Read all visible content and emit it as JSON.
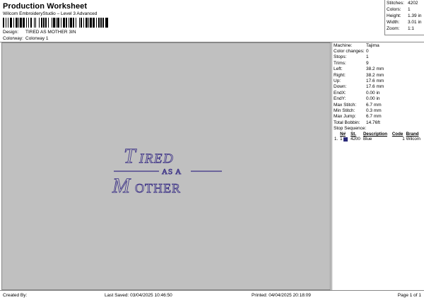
{
  "header": {
    "title": "Production Worksheet",
    "software": "Wilcom EmbroideryStudio – Level 3 Advanced",
    "design_label": "Design:",
    "design_value": "TIRED AS MOTHER 3IN",
    "colorway_label": "Colorway:",
    "colorway_value": "Colorway 1"
  },
  "summary": [
    {
      "label": "Stitches:",
      "value": "4202"
    },
    {
      "label": "Colors:",
      "value": "1"
    },
    {
      "label": "Height:",
      "value": "1.39 in"
    },
    {
      "label": "Width:",
      "value": "3.01 in"
    },
    {
      "label": "Zoom:",
      "value": "1:1"
    }
  ],
  "design_text": {
    "line1_big": "T",
    "line1_rest": "IRED",
    "line2": "AS A",
    "line3_big": "M",
    "line3_rest": "OTHER",
    "thread_color": "#3a2f86"
  },
  "machine_info": [
    {
      "label": "Machine:",
      "value": "Tajima"
    },
    {
      "label": "Color changes:",
      "value": "0"
    },
    {
      "label": "Stops:",
      "value": "1"
    },
    {
      "label": "Trims:",
      "value": "9"
    },
    {
      "label": "Left:",
      "value": "38.2 mm"
    },
    {
      "label": "Right:",
      "value": "38.2 mm"
    },
    {
      "label": "Up:",
      "value": "17.6 mm"
    },
    {
      "label": "Down:",
      "value": "17.6 mm"
    },
    {
      "label": "EndX:",
      "value": "0.00 in"
    },
    {
      "label": "EndY:",
      "value": "0.00 in"
    },
    {
      "label": "Max Stitch:",
      "value": "6.7 mm"
    },
    {
      "label": "Min Stitch:",
      "value": "0.3 mm"
    },
    {
      "label": "Max Jump:",
      "value": "6.7 mm"
    },
    {
      "label": "Total Bobbin:",
      "value": "14.76ft"
    }
  ],
  "stop_sequence": {
    "title": "Stop Sequence:",
    "headers": [
      "#",
      "N#",
      "St.",
      "Description",
      "Code",
      "Brand"
    ],
    "rows": [
      {
        "num": "1.",
        "n": "1",
        "swatch": "#2a2a7a",
        "st": "4200",
        "description": "Blue",
        "code": "1",
        "brand": "Wilcom"
      }
    ]
  },
  "footer": {
    "created_by": "Created By:",
    "last_saved": "Last Saved: 03/04/2025 10:46:50",
    "printed": "Printed: 04/04/2025 20:18:09",
    "page": "Page 1 of 1"
  }
}
